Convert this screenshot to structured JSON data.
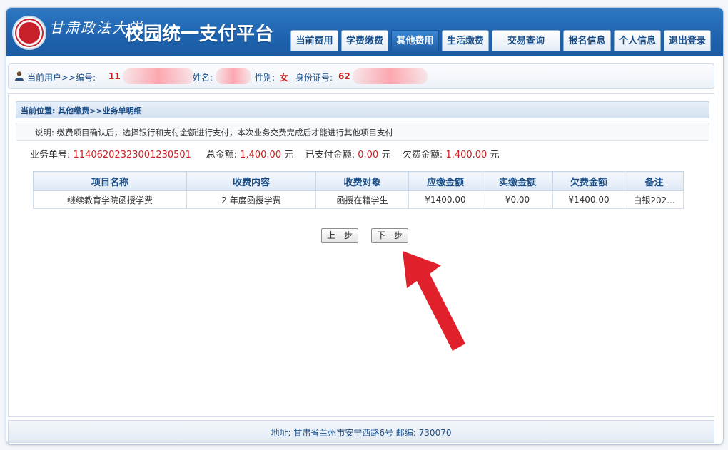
{
  "header": {
    "university_name": "甘肃政法大学",
    "system_title": "校园统一支付平台",
    "brand_color": "#1f63ae",
    "nav_tabs": [
      {
        "label": "当前费用",
        "active": false
      },
      {
        "label": "学费缴费",
        "active": false
      },
      {
        "label": "其他费用",
        "active": true
      },
      {
        "label": "生活缴费",
        "active": false
      },
      {
        "label": "交易查询",
        "active": false
      },
      {
        "label": "报名信息",
        "active": false
      },
      {
        "label": "个人信息",
        "active": false
      },
      {
        "label": "退出登录",
        "active": false
      }
    ]
  },
  "userbar": {
    "current_user_label": "当前用户>>编号:",
    "id_value": "11",
    "name_label": "姓名:",
    "gender_label": "性别:",
    "gender_value": "女",
    "idcard_label": "身份证号:",
    "idcard_value": "62"
  },
  "location": {
    "text": "当前位置: 其他缴费>>业务单明细"
  },
  "note": {
    "text": "说明: 缴费项目确认后，选择银行和支付金额进行支付，本次业务交费完成后才能进行其他项目支付"
  },
  "summary": {
    "order_label": "业务单号:",
    "order_value": "11406202323001230501",
    "total_label": "总金额:",
    "total_value": "1,400.00",
    "paid_label": "已支付金额:",
    "paid_value": "0.00",
    "owed_label": "欠费金额:",
    "owed_value": "1,400.00",
    "unit": "元"
  },
  "table": {
    "headers": [
      "项目名称",
      "收费内容",
      "收费对象",
      "应缴金额",
      "实缴金额",
      "欠费金额",
      "备注"
    ],
    "rows": [
      [
        "继续教育学院函授学费",
        "2 年度函授学费",
        "函授在籍学生",
        "¥1400.00",
        "¥0.00",
        "¥1400.00",
        "白银202..."
      ]
    ]
  },
  "buttons": {
    "prev": "上一步",
    "next": "下一步"
  },
  "footer": {
    "text": "地址: 甘肃省兰州市安宁西路6号 邮编: 730070"
  },
  "annotation": {
    "arrow_color": "#e0202a"
  }
}
